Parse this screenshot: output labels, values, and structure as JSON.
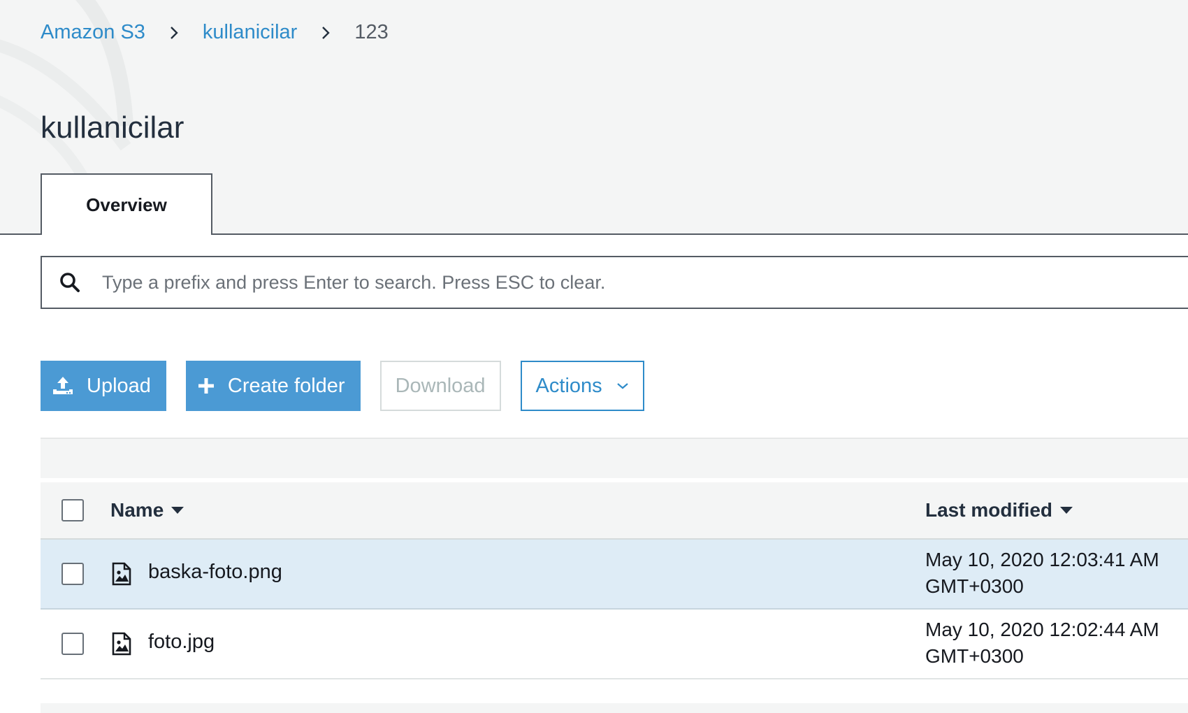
{
  "breadcrumb": {
    "root": "Amazon S3",
    "bucket": "kullanicilar",
    "current": "123"
  },
  "page": {
    "title": "kullanicilar"
  },
  "tabs": [
    {
      "label": "Overview",
      "active": true
    }
  ],
  "search": {
    "placeholder": "Type a prefix and press Enter to search. Press ESC to clear.",
    "value": ""
  },
  "toolbar": {
    "upload_label": "Upload",
    "create_folder_label": "Create folder",
    "download_label": "Download",
    "actions_label": "Actions"
  },
  "table": {
    "columns": {
      "name": "Name",
      "last_modified": "Last modified"
    },
    "rows": [
      {
        "name": "baska-foto.png",
        "modified_date": "May 10, 2020 12:03:41 AM",
        "modified_tz": "GMT+0300",
        "selected": true
      },
      {
        "name": "foto.jpg",
        "modified_date": "May 10, 2020 12:02:44 AM",
        "modified_tz": "GMT+0300",
        "selected": false
      }
    ]
  },
  "colors": {
    "link": "#2e8bc9",
    "primary_button": "#4b9ad4",
    "selected_row": "#deecf6"
  },
  "icons": {
    "search": "search-icon",
    "upload": "upload-icon",
    "create_folder": "plus-icon",
    "actions": "chevron-down-icon",
    "sort": "caret-down-icon",
    "file": "image-file-icon"
  }
}
